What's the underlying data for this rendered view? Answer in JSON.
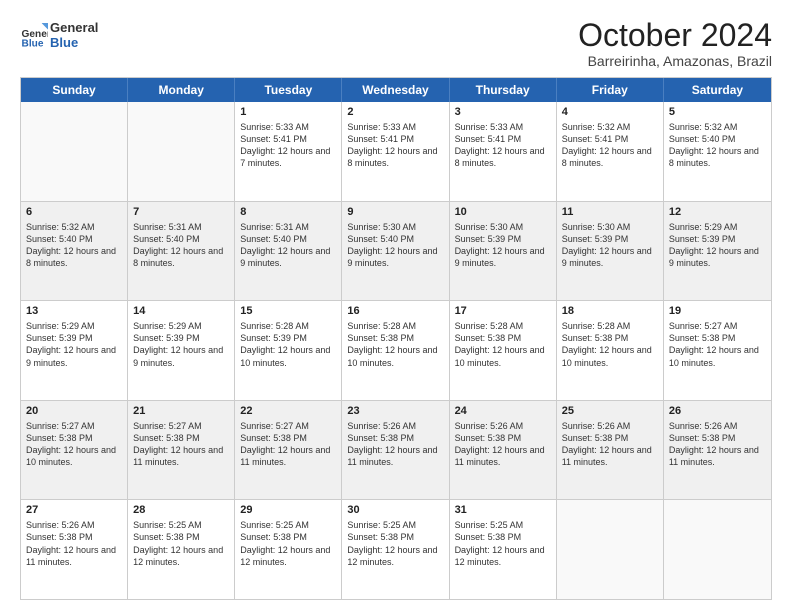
{
  "logo": {
    "general": "General",
    "blue": "Blue"
  },
  "header": {
    "month": "October 2024",
    "location": "Barreirinha, Amazonas, Brazil"
  },
  "days": [
    "Sunday",
    "Monday",
    "Tuesday",
    "Wednesday",
    "Thursday",
    "Friday",
    "Saturday"
  ],
  "rows": [
    [
      {
        "day": "",
        "info": ""
      },
      {
        "day": "",
        "info": ""
      },
      {
        "day": "1",
        "info": "Sunrise: 5:33 AM\nSunset: 5:41 PM\nDaylight: 12 hours and 7 minutes."
      },
      {
        "day": "2",
        "info": "Sunrise: 5:33 AM\nSunset: 5:41 PM\nDaylight: 12 hours and 8 minutes."
      },
      {
        "day": "3",
        "info": "Sunrise: 5:33 AM\nSunset: 5:41 PM\nDaylight: 12 hours and 8 minutes."
      },
      {
        "day": "4",
        "info": "Sunrise: 5:32 AM\nSunset: 5:41 PM\nDaylight: 12 hours and 8 minutes."
      },
      {
        "day": "5",
        "info": "Sunrise: 5:32 AM\nSunset: 5:40 PM\nDaylight: 12 hours and 8 minutes."
      }
    ],
    [
      {
        "day": "6",
        "info": "Sunrise: 5:32 AM\nSunset: 5:40 PM\nDaylight: 12 hours and 8 minutes."
      },
      {
        "day": "7",
        "info": "Sunrise: 5:31 AM\nSunset: 5:40 PM\nDaylight: 12 hours and 8 minutes."
      },
      {
        "day": "8",
        "info": "Sunrise: 5:31 AM\nSunset: 5:40 PM\nDaylight: 12 hours and 9 minutes."
      },
      {
        "day": "9",
        "info": "Sunrise: 5:30 AM\nSunset: 5:40 PM\nDaylight: 12 hours and 9 minutes."
      },
      {
        "day": "10",
        "info": "Sunrise: 5:30 AM\nSunset: 5:39 PM\nDaylight: 12 hours and 9 minutes."
      },
      {
        "day": "11",
        "info": "Sunrise: 5:30 AM\nSunset: 5:39 PM\nDaylight: 12 hours and 9 minutes."
      },
      {
        "day": "12",
        "info": "Sunrise: 5:29 AM\nSunset: 5:39 PM\nDaylight: 12 hours and 9 minutes."
      }
    ],
    [
      {
        "day": "13",
        "info": "Sunrise: 5:29 AM\nSunset: 5:39 PM\nDaylight: 12 hours and 9 minutes."
      },
      {
        "day": "14",
        "info": "Sunrise: 5:29 AM\nSunset: 5:39 PM\nDaylight: 12 hours and 9 minutes."
      },
      {
        "day": "15",
        "info": "Sunrise: 5:28 AM\nSunset: 5:39 PM\nDaylight: 12 hours and 10 minutes."
      },
      {
        "day": "16",
        "info": "Sunrise: 5:28 AM\nSunset: 5:38 PM\nDaylight: 12 hours and 10 minutes."
      },
      {
        "day": "17",
        "info": "Sunrise: 5:28 AM\nSunset: 5:38 PM\nDaylight: 12 hours and 10 minutes."
      },
      {
        "day": "18",
        "info": "Sunrise: 5:28 AM\nSunset: 5:38 PM\nDaylight: 12 hours and 10 minutes."
      },
      {
        "day": "19",
        "info": "Sunrise: 5:27 AM\nSunset: 5:38 PM\nDaylight: 12 hours and 10 minutes."
      }
    ],
    [
      {
        "day": "20",
        "info": "Sunrise: 5:27 AM\nSunset: 5:38 PM\nDaylight: 12 hours and 10 minutes."
      },
      {
        "day": "21",
        "info": "Sunrise: 5:27 AM\nSunset: 5:38 PM\nDaylight: 12 hours and 11 minutes."
      },
      {
        "day": "22",
        "info": "Sunrise: 5:27 AM\nSunset: 5:38 PM\nDaylight: 12 hours and 11 minutes."
      },
      {
        "day": "23",
        "info": "Sunrise: 5:26 AM\nSunset: 5:38 PM\nDaylight: 12 hours and 11 minutes."
      },
      {
        "day": "24",
        "info": "Sunrise: 5:26 AM\nSunset: 5:38 PM\nDaylight: 12 hours and 11 minutes."
      },
      {
        "day": "25",
        "info": "Sunrise: 5:26 AM\nSunset: 5:38 PM\nDaylight: 12 hours and 11 minutes."
      },
      {
        "day": "26",
        "info": "Sunrise: 5:26 AM\nSunset: 5:38 PM\nDaylight: 12 hours and 11 minutes."
      }
    ],
    [
      {
        "day": "27",
        "info": "Sunrise: 5:26 AM\nSunset: 5:38 PM\nDaylight: 12 hours and 11 minutes."
      },
      {
        "day": "28",
        "info": "Sunrise: 5:25 AM\nSunset: 5:38 PM\nDaylight: 12 hours and 12 minutes."
      },
      {
        "day": "29",
        "info": "Sunrise: 5:25 AM\nSunset: 5:38 PM\nDaylight: 12 hours and 12 minutes."
      },
      {
        "day": "30",
        "info": "Sunrise: 5:25 AM\nSunset: 5:38 PM\nDaylight: 12 hours and 12 minutes."
      },
      {
        "day": "31",
        "info": "Sunrise: 5:25 AM\nSunset: 5:38 PM\nDaylight: 12 hours and 12 minutes."
      },
      {
        "day": "",
        "info": ""
      },
      {
        "day": "",
        "info": ""
      }
    ]
  ]
}
